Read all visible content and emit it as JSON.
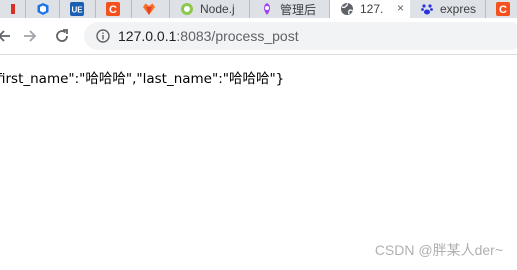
{
  "browser": {
    "tabs": [
      {
        "title": "",
        "icon": "red-favicon-icon"
      },
      {
        "title": "",
        "icon": "blue-shield-icon"
      },
      {
        "title": "",
        "icon": "ue-favicon-icon"
      },
      {
        "title": "",
        "icon": "c-favicon-icon"
      },
      {
        "title": "",
        "icon": "orange-favicon-icon"
      },
      {
        "title": "Node.j",
        "icon": "node-icon"
      },
      {
        "title": "管理后",
        "icon": "admin-icon"
      },
      {
        "title": "127.",
        "icon": "globe-icon",
        "active": true
      },
      {
        "title": "expres",
        "icon": "baidu-paw-icon"
      },
      {
        "title": "",
        "icon": "c-favicon-icon"
      }
    ],
    "close_glyph": "×",
    "url_host": "127.0.0.1",
    "url_port_path": ":8083/process_post"
  },
  "page": {
    "body_text": "first_name\":\"哈哈哈\",\"last_name\":\"哈哈哈\"}"
  },
  "watermark": "CSDN @胖某人der~",
  "colors": {
    "tab_strip": "#dee1e6",
    "omnibox": "#f1f3f4",
    "c_red": "#f4511e",
    "ue_blue": "#1a5fb4"
  }
}
